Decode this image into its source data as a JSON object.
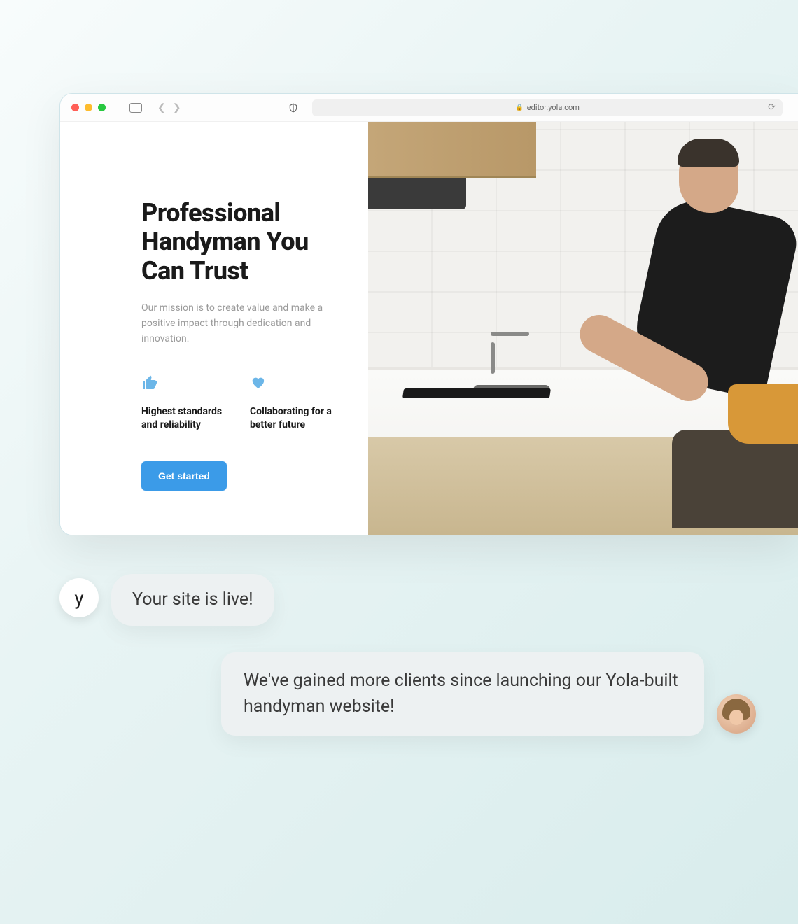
{
  "browser": {
    "url": "editor.yola.com"
  },
  "hero": {
    "title": "Professional Handyman You Can Trust",
    "subtitle": "Our mission is to create value and make a positive impact through dedication and innovation.",
    "cta_label": "Get started"
  },
  "features": [
    {
      "icon": "thumbs-up",
      "text": "Highest standards and reliability"
    },
    {
      "icon": "heart",
      "text": "Collaborating for a better future"
    }
  ],
  "chat": {
    "brand_avatar_glyph": "y",
    "msg1": "Your site is live!",
    "msg2": "We've gained more clients since launching our Yola-built handyman website!"
  }
}
